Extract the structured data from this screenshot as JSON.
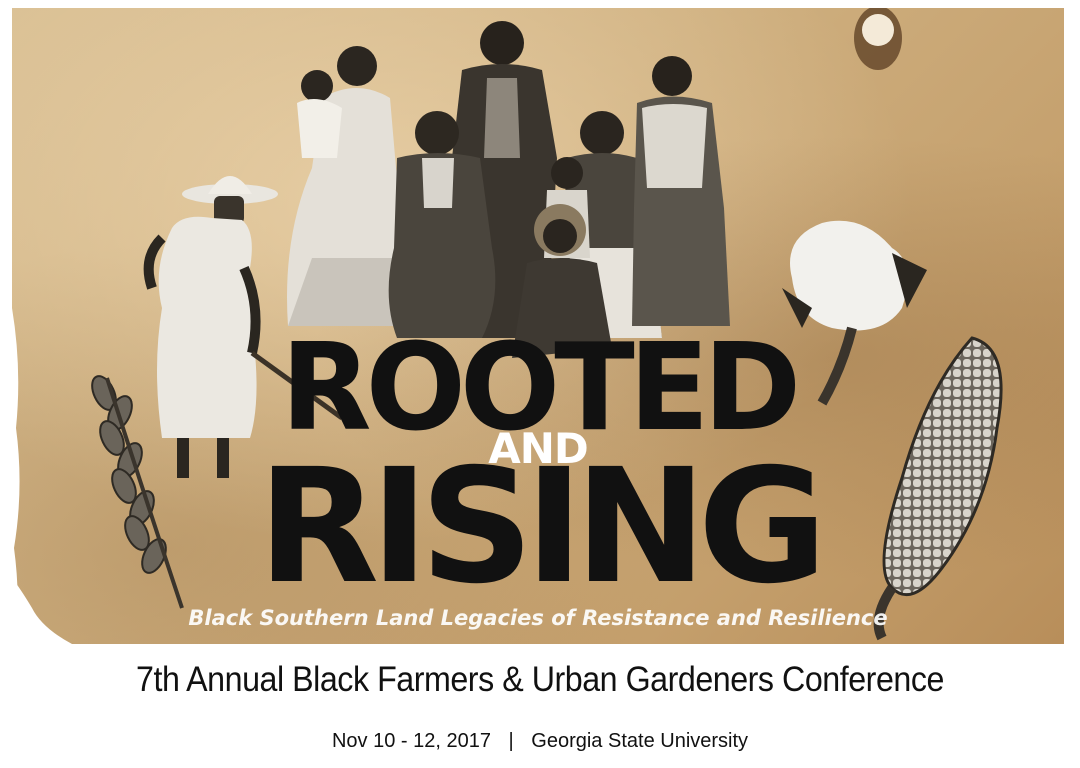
{
  "poster": {
    "title_line1": "ROOTED",
    "title_connector": "AND",
    "title_line2": "RISING",
    "subtitle": "Black Southern Land Legacies of Resistance and Resilience",
    "images": [
      "family-group-photo",
      "woman-hoeing-photo",
      "cotton-boll",
      "corn-cob",
      "wheat-stalk"
    ]
  },
  "conference": {
    "name": "7th Annual Black Farmers & Urban Gardeners Conference",
    "dates": "Nov 10 - 12, 2017",
    "separator": "|",
    "venue": "Georgia State University"
  },
  "colors": {
    "parchment": "#cfb080",
    "title": "#111111",
    "subtitle": "#ffffff"
  }
}
